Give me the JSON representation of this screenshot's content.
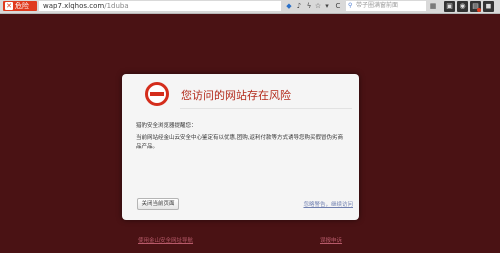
{
  "toolbar": {
    "danger_label": "危险",
    "url_host": "wap7.xlqhos.com",
    "url_path": "/1duba",
    "search_placeholder": "带子圈满窗前面",
    "refresh_glyph": "C"
  },
  "card": {
    "title": "您访问的网站存在风险",
    "greeting": "猎豹安全浏览器提醒您：",
    "message": "当前网站经金山云安全中心鉴定有以优惠,团购,返利付款等方式诱导您购买假冒伪劣商品产品。",
    "close_button": "关闭当前页面",
    "ignore_link": "忽略警告，继续访问"
  },
  "footer": {
    "left_link": "使用金山安全网址导航",
    "right_link": "误报申诉"
  }
}
